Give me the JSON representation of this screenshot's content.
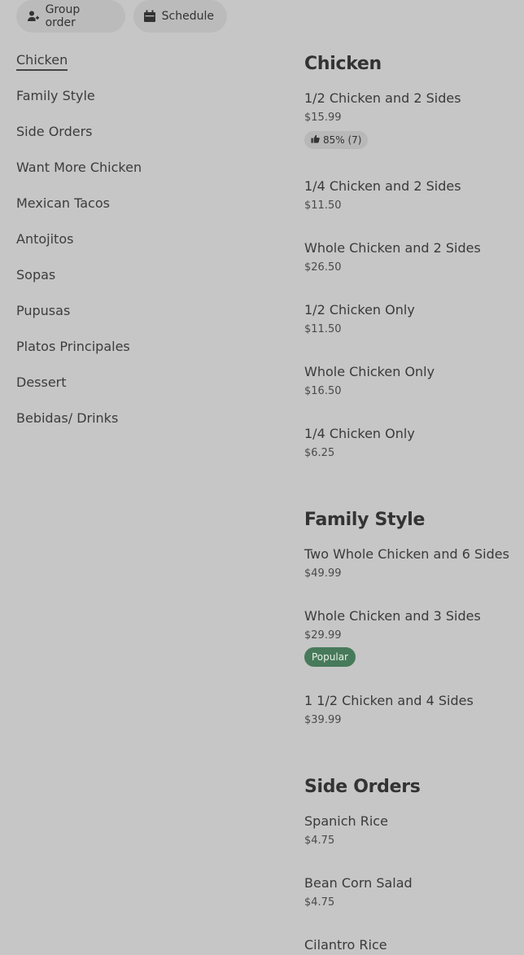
{
  "top_actions": {
    "group_order": "Group order",
    "schedule": "Schedule"
  },
  "nav": {
    "items": [
      "Chicken",
      "Family Style",
      "Side Orders",
      "Want More Chicken",
      "Mexican Tacos",
      "Antojitos",
      "Sopas",
      "Pupusas",
      "Platos Principales",
      "Dessert",
      "Bebidas/ Drinks"
    ]
  },
  "sections": {
    "chicken": {
      "title": "Chicken",
      "items": [
        {
          "name": "1/2 Chicken and 2 Sides",
          "price": "$15.99",
          "rating": "85% (7)"
        },
        {
          "name": "1/4 Chicken and 2 Sides",
          "price": "$11.50"
        },
        {
          "name": "Whole Chicken and 2 Sides",
          "price": "$26.50"
        },
        {
          "name": "1/2 Chicken Only",
          "price": "$11.50"
        },
        {
          "name": "Whole Chicken Only",
          "price": "$16.50"
        },
        {
          "name": "1/4 Chicken Only",
          "price": "$6.25"
        }
      ]
    },
    "family": {
      "title": "Family Style",
      "items": [
        {
          "name": "Two Whole Chicken and 6 Sides",
          "price": "$49.99"
        },
        {
          "name": "Whole Chicken and 3 Sides",
          "price": "$29.99",
          "badge": "Popular"
        },
        {
          "name": "1 1/2 Chicken and 4 Sides",
          "price": "$39.99"
        }
      ]
    },
    "sides": {
      "title": "Side Orders",
      "items": [
        {
          "name": "Spanich Rice",
          "price": "$4.75"
        },
        {
          "name": "Bean Corn Salad",
          "price": "$4.75"
        },
        {
          "name": "Cilantro Rice",
          "price": ""
        }
      ]
    }
  },
  "colors": {
    "background": "#c6c6c6",
    "pill": "#bbbbbb",
    "popular_badge": "#477a5a"
  }
}
